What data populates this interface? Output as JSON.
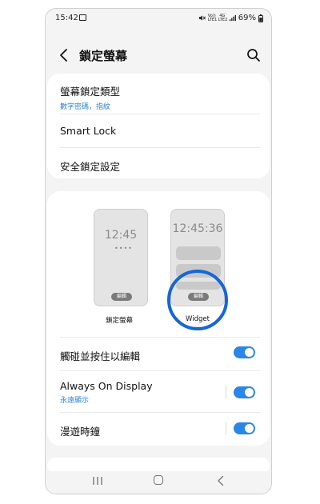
{
  "status_bar": {
    "time": "15:42",
    "volte1": "Vo)) LTE1",
    "volte2": "4G LTE2",
    "battery": "69%"
  },
  "header": {
    "title": "鎖定螢幕"
  },
  "settings": {
    "lock_type": {
      "label": "螢幕鎖定類型",
      "value": "數字密碼，指紋"
    },
    "smart_lock": {
      "label": "Smart Lock"
    },
    "secure_lock": {
      "label": "安全鎖定設定"
    }
  },
  "preview": {
    "lock": {
      "time": "12:45",
      "dots": "••••",
      "edit": "編輯",
      "label": "鎖定螢幕"
    },
    "widget": {
      "time": "12:45:36",
      "edit": "編輯",
      "label": "Widget"
    }
  },
  "toggles": {
    "touch_hold": {
      "label": "觸碰並按住以編輯",
      "on": true
    },
    "aod": {
      "label": "Always On Display",
      "value": "永遠顯示",
      "on": true
    },
    "roaming": {
      "label": "漫遊時鐘",
      "on": true
    }
  },
  "colors": {
    "accent": "#2a86e8",
    "highlight_ring": "#1766d6",
    "subtext": "#2f86d6"
  }
}
